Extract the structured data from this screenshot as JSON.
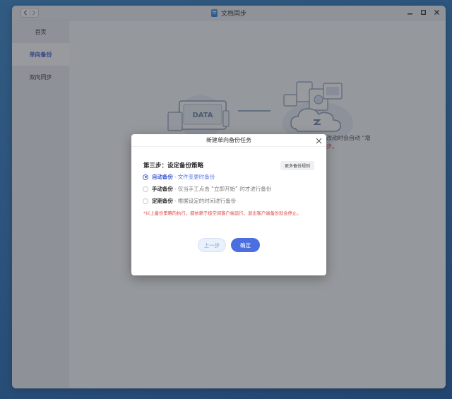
{
  "window": {
    "title": "文档同步",
    "back_icon": "chevron-left-icon",
    "forward_icon": "chevron-right-icon",
    "controls": [
      "minimize-icon",
      "maximize-icon",
      "close-icon"
    ]
  },
  "sidebar": {
    "items": [
      {
        "label": "首页",
        "active": false
      },
      {
        "label": "单向备份",
        "active": true
      },
      {
        "label": "双向同步",
        "active": false
      }
    ]
  },
  "background": {
    "illustration_left_label": "DATA",
    "partial_text_1": "改动时会自动 “增",
    "partial_text_2": "步。"
  },
  "dialog": {
    "title": "新建单向备份任务",
    "step_title": "第三步：设定备份策略",
    "more_rules_button": "更多备份规则",
    "options": [
      {
        "name": "自动备份",
        "separator": "-",
        "desc": "文件变更时备份",
        "checked": true
      },
      {
        "name": "手动备份",
        "separator": "-",
        "desc": "仅当手工点击 “立即开始” 时才进行备份",
        "checked": false
      },
      {
        "name": "定期备份",
        "separator": "-",
        "desc": "根据设定的时间进行备份",
        "checked": false
      }
    ],
    "note": "*以上备份策略的执行，都依赖于极空间客户端运行，退出客户端备份就会停止。",
    "prev_button": "上一步",
    "confirm_button": "确定"
  },
  "colors": {
    "accent": "#4c6fdf",
    "sidebar_active_text": "#3d5bd1",
    "warning_text": "#e24a4a"
  }
}
